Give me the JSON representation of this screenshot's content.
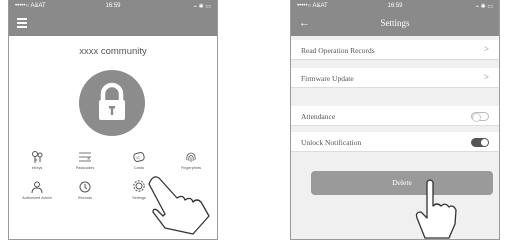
{
  "left_screen": {
    "status": {
      "carrier": "•••••○ A&AT",
      "wifi": "ᯤ",
      "time": "16:59",
      "right": "⌁ ✱ ▭"
    },
    "community": "xxxx community",
    "grid": [
      {
        "label": "eKeys",
        "icon": "ekeys-icon"
      },
      {
        "label": "Passcodes",
        "icon": "passcodes-icon"
      },
      {
        "label": "Cards",
        "icon": "cards-icon"
      },
      {
        "label": "Fingerprints",
        "icon": "fingerprint-icon"
      },
      {
        "label": "Authorized Admin",
        "icon": "admin-icon"
      },
      {
        "label": "Records",
        "icon": "records-icon"
      },
      {
        "label": "Settings",
        "icon": "settings-icon"
      }
    ]
  },
  "right_screen": {
    "status": {
      "carrier": "•••••○ A&AT",
      "wifi": "ᯤ",
      "time": "16:59",
      "right": "⌁ ✱ ▭"
    },
    "title": "Settings",
    "back": "←",
    "rows": {
      "read_records": "Read Operation Records",
      "firmware": "Firmware Update",
      "attendance": "Attendance",
      "unlock_notification": "Unlock Notification"
    },
    "chevron": ">",
    "toggles": {
      "attendance": false,
      "unlock_notification": true
    },
    "delete_label": "Delete"
  }
}
